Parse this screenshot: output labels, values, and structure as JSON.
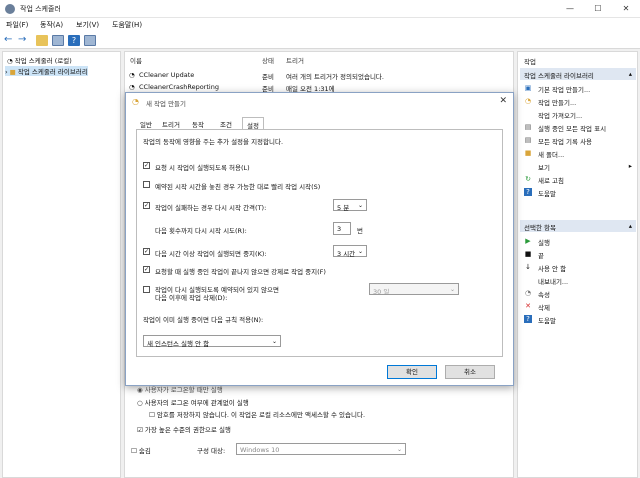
{
  "window": {
    "title": "작업 스케줄러",
    "minimize": "—",
    "maximize": "☐",
    "close": "✕"
  },
  "menu": [
    "파일(F)",
    "동작(A)",
    "보기(V)",
    "도움말(H)"
  ],
  "tree": [
    "작업 스케줄러 (로컬)",
    "작업 스케줄러 라이브러리"
  ],
  "columns": [
    "이름",
    "상태",
    "트리거"
  ],
  "tasks": [
    {
      "name": "CCleaner Update",
      "status": "준비",
      "trigger": "여러 개의 트리거가 정의되었습니다."
    },
    {
      "name": "CCleanerCrashReporting",
      "status": "준비",
      "trigger": "매일 오전 1:31에"
    }
  ],
  "right_pane": {
    "section1": "작업",
    "section1_sub": "작업 스케줄러 라이브러리",
    "items1": [
      "기본 작업 만들기...",
      "작업 만들기...",
      "작업 가져오기...",
      "실행 중인 모든 작업 표시",
      "모든 작업 기록 사용",
      "새 폴더...",
      "보기",
      "새로 고침",
      "도움말"
    ],
    "section2": "선택한 항목",
    "items2": [
      "실행",
      "끝",
      "사용 안 함",
      "내보내기...",
      "속성",
      "삭제",
      "도움말"
    ]
  },
  "dialog": {
    "title": "새 작업 만들기",
    "tabs": [
      "일반",
      "트리거",
      "동작",
      "조건",
      "설정"
    ],
    "intro": "작업의 동작에 영향을 주는 추가 설정을 지정합니다.",
    "opt1": "요청 시 작업이 실행되도록 허용(L)",
    "opt2": "예약된 시작 시간을 놓친 경우 가능한 대로 빨리 작업 시작(S)",
    "opt3": "작업이 실패하는 경우 다시 시작 간격(T):",
    "opt3_value": "5 분",
    "retry_label": "다음 횟수까지 다시 시작 시도(R):",
    "retry_value": "3",
    "retry_unit": "번",
    "opt4": "다음 시간 이상 작업이 실행되면 중지(K):",
    "opt4_value": "3 시간",
    "opt5": "요청할 때 실행 중인 작업이 끝나지 않으면 강제로 작업 중지(F)",
    "opt6_line1": "작업이 다시 실행되도록 예약되어 있지 않으면",
    "opt6_line2": "다음 이후에 작업 삭제(D):",
    "opt6_value": "30 일",
    "rule_label": "작업이 이미 실행 중이면 다음 규칙 적용(N):",
    "rule_value": "새 인스턴스 실행 안 함",
    "ok": "확인",
    "cancel": "취소"
  },
  "behind": {
    "line1": "사용자가 로그온할 때만 실행",
    "line2": "사용자의 로그온 여부에 관계없이 실행",
    "line3": "암호를 저장하지 않습니다. 이 작업은 로컬 리소스에만 액세스할 수 있습니다.",
    "line4": "가장 높은 수준의 권한으로 실행",
    "hidden": "숨김",
    "config_label": "구성 대상:",
    "config_value": "Windows 10"
  }
}
